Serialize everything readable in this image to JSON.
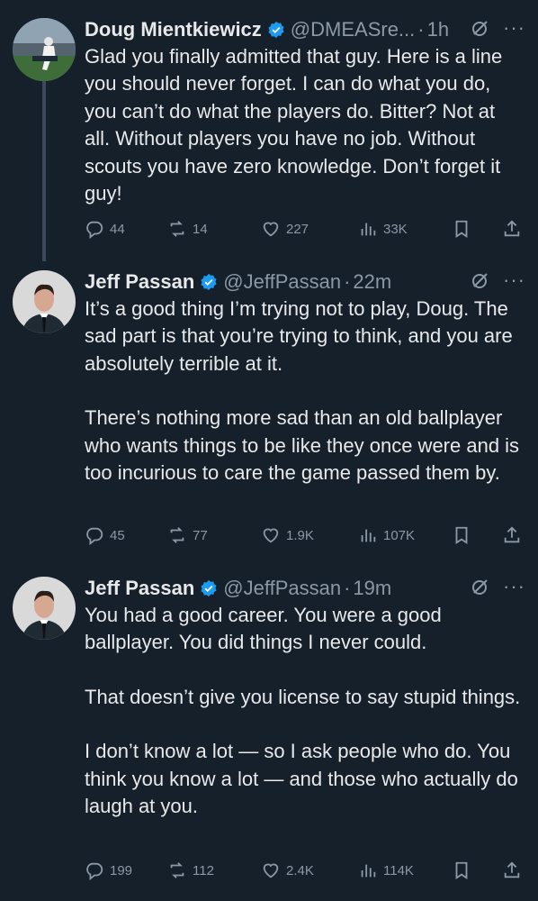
{
  "tweets": [
    {
      "name": "Doug Mientkiewicz",
      "handle": "@DMEASre...",
      "time": "1h",
      "paragraphs": [
        "Glad you finally admitted that guy.  Here is a line you should never forget.  I can do what you do, you can’t do what the players do. Bitter?  Not at all. Without players you have no job. Without scouts you have zero knowledge. Don’t forget it guy!"
      ],
      "replies": "44",
      "reposts": "14",
      "likes": "227",
      "views": "33K"
    },
    {
      "name": "Jeff Passan",
      "handle": "@JeffPassan",
      "time": "22m",
      "paragraphs": [
        "It’s a good thing I’m trying not to play, Doug. The sad part is that you’re trying to think, and you are absolutely terrible at it.",
        "There’s nothing more sad than an old ballplayer who wants things to be like they once were and is too incurious to care the game passed them by."
      ],
      "replies": "45",
      "reposts": "77",
      "likes": "1.9K",
      "views": "107K"
    },
    {
      "name": "Jeff Passan",
      "handle": "@JeffPassan",
      "time": "19m",
      "paragraphs": [
        "You had a good career. You were a good ballplayer. You did things I never could.",
        "That doesn’t give you license to say stupid things.",
        "I don’t know a lot — so I ask people who do. You think you know a lot — and those who actually do laugh at you."
      ],
      "replies": "199",
      "reposts": "112",
      "likes": "2.4K",
      "views": "114K"
    }
  ],
  "icons": {
    "reply": "reply-icon",
    "repost": "repost-icon",
    "like": "heart-icon",
    "views": "views-icon",
    "bookmark": "bookmark-icon",
    "share": "share-icon",
    "grok": "grok-icon",
    "more": "more-icon",
    "verified": "verified-badge-icon"
  },
  "colors": {
    "background": "#15202b",
    "text": "#e7e9ea",
    "muted": "#8b98a5",
    "verified": "#1d9bf0"
  }
}
